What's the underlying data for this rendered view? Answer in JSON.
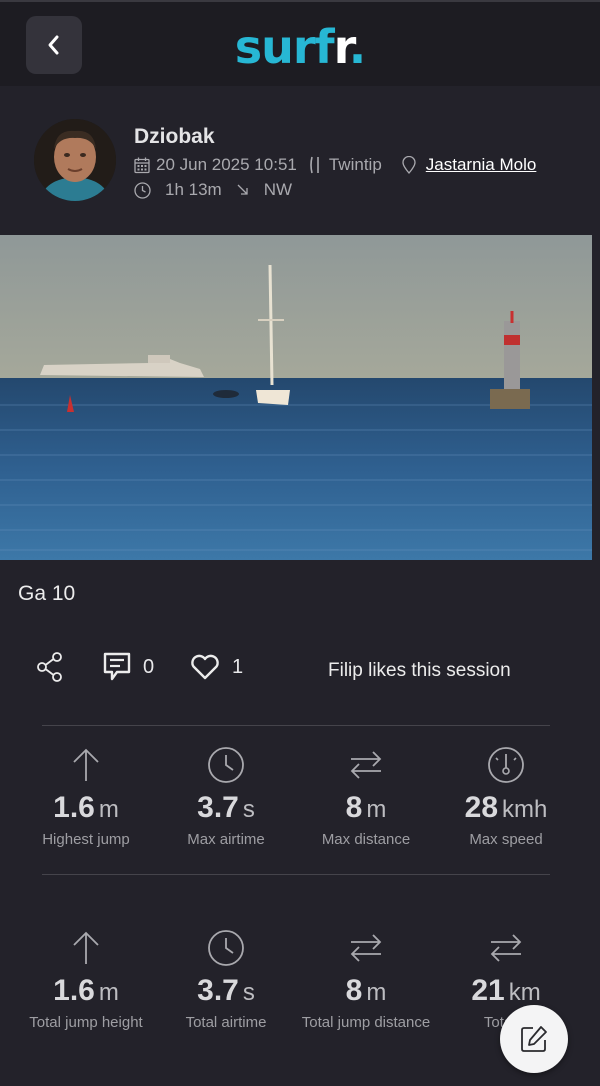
{
  "header": {
    "back_label": "",
    "logo_main": "surf",
    "logo_r": "r",
    "logo_dot": "."
  },
  "profile": {
    "name": "Dziobak",
    "date": "20 Jun 2025 10:51",
    "board": "Twintip",
    "location": "Jastarnia Molo",
    "duration": "1h 13m",
    "wind": "NW"
  },
  "session": {
    "caption": "Ga 10"
  },
  "actions": {
    "comments": "0",
    "likes": "1",
    "likes_text": "Filip likes this session"
  },
  "stats_top": [
    {
      "icon": "arrow-up-icon",
      "value": "1.6",
      "unit": "m",
      "label": "Highest jump"
    },
    {
      "icon": "clock-icon",
      "value": "3.7",
      "unit": "s",
      "label": "Max airtime"
    },
    {
      "icon": "swap-arrows-icon",
      "value": "8",
      "unit": "m",
      "label": "Max distance"
    },
    {
      "icon": "speedometer-icon",
      "value": "28",
      "unit": "kmh",
      "label": "Max speed"
    }
  ],
  "stats_bottom": [
    {
      "icon": "arrow-up-icon",
      "value": "1.6",
      "unit": "m",
      "label": "Total jump height"
    },
    {
      "icon": "clock-icon",
      "value": "3.7",
      "unit": "s",
      "label": "Total airtime"
    },
    {
      "icon": "swap-arrows-icon",
      "value": "8",
      "unit": "m",
      "label": "Total jump distance"
    },
    {
      "icon": "swap-arrows-icon",
      "value": "21",
      "unit": "km",
      "label": "Total d"
    }
  ],
  "colors": {
    "background": "#23222a",
    "header": "#1d1c22",
    "brand": "#27b7d4"
  }
}
